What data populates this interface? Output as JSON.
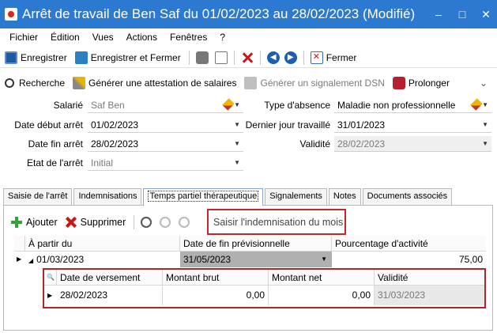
{
  "window": {
    "title": "Arrêt de travail de Ben Saf du 01/02/2023 au 28/02/2023 (Modifié)"
  },
  "menu": [
    "Fichier",
    "Édition",
    "Vues",
    "Actions",
    "Fenêtres",
    "?"
  ],
  "toolbar": {
    "save": "Enregistrer",
    "save_close": "Enregistrer et Fermer",
    "close": "Fermer"
  },
  "toolbar2": {
    "search": "Recherche",
    "generate": "Générer une attestation de salaires",
    "dsn": "Générer un signalement DSN",
    "prolong": "Prolonger"
  },
  "form": {
    "salarie_label": "Salarié",
    "salarie_value": "Saf Ben",
    "debut_label": "Date début arrêt",
    "debut_value": "01/02/2023",
    "fin_label": "Date fin arrêt",
    "fin_value": "28/02/2023",
    "etat_label": "Etat de l'arrêt",
    "etat_value": "Initial",
    "type_label": "Type d'absence",
    "type_value": "Maladie non professionnelle",
    "dernier_label": "Dernier jour travaillé",
    "dernier_value": "31/01/2023",
    "validite_label": "Validité",
    "validite_value": "28/02/2023"
  },
  "tabs": [
    "Saisie de l'arrêt",
    "Indemnisations",
    "Temps partiel thérapeutique",
    "Signalements",
    "Notes",
    "Documents associés"
  ],
  "panel": {
    "add": "Ajouter",
    "delete": "Supprimer",
    "saisir": "Saisir l'indemnisation du mois"
  },
  "grid": {
    "headers": [
      "À partir du",
      "Date de fin prévisionnelle",
      "Pourcentage d'activité"
    ],
    "row": {
      "start": "01/03/2023",
      "end": "31/05/2023",
      "pct": "75,00"
    }
  },
  "subgrid": {
    "headers": [
      "Date de versement",
      "Montant brut",
      "Montant net",
      "Validité"
    ],
    "row": {
      "date": "28/02/2023",
      "brut": "0,00",
      "net": "0,00",
      "validite": "31/03/2023"
    }
  }
}
